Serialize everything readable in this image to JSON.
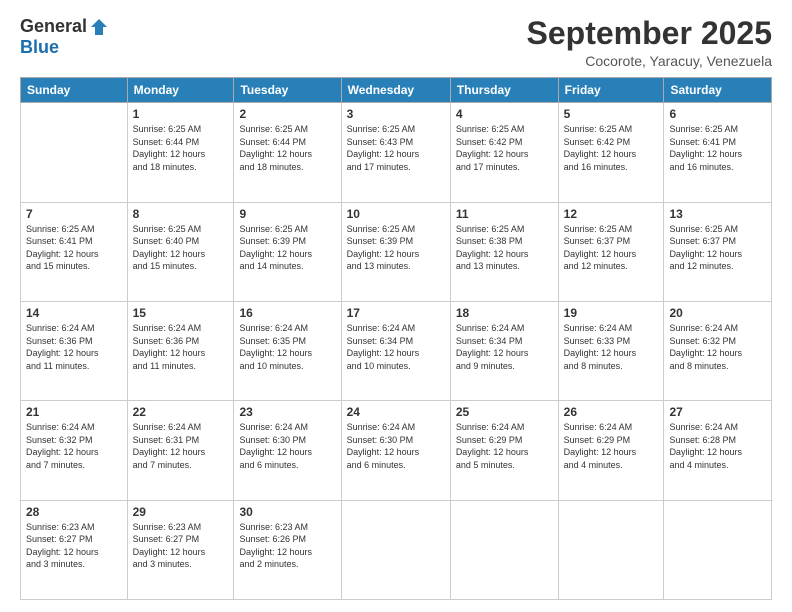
{
  "logo": {
    "general": "General",
    "blue": "Blue"
  },
  "header": {
    "month": "September 2025",
    "location": "Cocorote, Yaracuy, Venezuela"
  },
  "weekdays": [
    "Sunday",
    "Monday",
    "Tuesday",
    "Wednesday",
    "Thursday",
    "Friday",
    "Saturday"
  ],
  "weeks": [
    [
      {
        "day": "",
        "info": ""
      },
      {
        "day": "1",
        "info": "Sunrise: 6:25 AM\nSunset: 6:44 PM\nDaylight: 12 hours\nand 18 minutes."
      },
      {
        "day": "2",
        "info": "Sunrise: 6:25 AM\nSunset: 6:44 PM\nDaylight: 12 hours\nand 18 minutes."
      },
      {
        "day": "3",
        "info": "Sunrise: 6:25 AM\nSunset: 6:43 PM\nDaylight: 12 hours\nand 17 minutes."
      },
      {
        "day": "4",
        "info": "Sunrise: 6:25 AM\nSunset: 6:42 PM\nDaylight: 12 hours\nand 17 minutes."
      },
      {
        "day": "5",
        "info": "Sunrise: 6:25 AM\nSunset: 6:42 PM\nDaylight: 12 hours\nand 16 minutes."
      },
      {
        "day": "6",
        "info": "Sunrise: 6:25 AM\nSunset: 6:41 PM\nDaylight: 12 hours\nand 16 minutes."
      }
    ],
    [
      {
        "day": "7",
        "info": "Sunrise: 6:25 AM\nSunset: 6:41 PM\nDaylight: 12 hours\nand 15 minutes."
      },
      {
        "day": "8",
        "info": "Sunrise: 6:25 AM\nSunset: 6:40 PM\nDaylight: 12 hours\nand 15 minutes."
      },
      {
        "day": "9",
        "info": "Sunrise: 6:25 AM\nSunset: 6:39 PM\nDaylight: 12 hours\nand 14 minutes."
      },
      {
        "day": "10",
        "info": "Sunrise: 6:25 AM\nSunset: 6:39 PM\nDaylight: 12 hours\nand 13 minutes."
      },
      {
        "day": "11",
        "info": "Sunrise: 6:25 AM\nSunset: 6:38 PM\nDaylight: 12 hours\nand 13 minutes."
      },
      {
        "day": "12",
        "info": "Sunrise: 6:25 AM\nSunset: 6:37 PM\nDaylight: 12 hours\nand 12 minutes."
      },
      {
        "day": "13",
        "info": "Sunrise: 6:25 AM\nSunset: 6:37 PM\nDaylight: 12 hours\nand 12 minutes."
      }
    ],
    [
      {
        "day": "14",
        "info": "Sunrise: 6:24 AM\nSunset: 6:36 PM\nDaylight: 12 hours\nand 11 minutes."
      },
      {
        "day": "15",
        "info": "Sunrise: 6:24 AM\nSunset: 6:36 PM\nDaylight: 12 hours\nand 11 minutes."
      },
      {
        "day": "16",
        "info": "Sunrise: 6:24 AM\nSunset: 6:35 PM\nDaylight: 12 hours\nand 10 minutes."
      },
      {
        "day": "17",
        "info": "Sunrise: 6:24 AM\nSunset: 6:34 PM\nDaylight: 12 hours\nand 10 minutes."
      },
      {
        "day": "18",
        "info": "Sunrise: 6:24 AM\nSunset: 6:34 PM\nDaylight: 12 hours\nand 9 minutes."
      },
      {
        "day": "19",
        "info": "Sunrise: 6:24 AM\nSunset: 6:33 PM\nDaylight: 12 hours\nand 8 minutes."
      },
      {
        "day": "20",
        "info": "Sunrise: 6:24 AM\nSunset: 6:32 PM\nDaylight: 12 hours\nand 8 minutes."
      }
    ],
    [
      {
        "day": "21",
        "info": "Sunrise: 6:24 AM\nSunset: 6:32 PM\nDaylight: 12 hours\nand 7 minutes."
      },
      {
        "day": "22",
        "info": "Sunrise: 6:24 AM\nSunset: 6:31 PM\nDaylight: 12 hours\nand 7 minutes."
      },
      {
        "day": "23",
        "info": "Sunrise: 6:24 AM\nSunset: 6:30 PM\nDaylight: 12 hours\nand 6 minutes."
      },
      {
        "day": "24",
        "info": "Sunrise: 6:24 AM\nSunset: 6:30 PM\nDaylight: 12 hours\nand 6 minutes."
      },
      {
        "day": "25",
        "info": "Sunrise: 6:24 AM\nSunset: 6:29 PM\nDaylight: 12 hours\nand 5 minutes."
      },
      {
        "day": "26",
        "info": "Sunrise: 6:24 AM\nSunset: 6:29 PM\nDaylight: 12 hours\nand 4 minutes."
      },
      {
        "day": "27",
        "info": "Sunrise: 6:24 AM\nSunset: 6:28 PM\nDaylight: 12 hours\nand 4 minutes."
      }
    ],
    [
      {
        "day": "28",
        "info": "Sunrise: 6:23 AM\nSunset: 6:27 PM\nDaylight: 12 hours\nand 3 minutes."
      },
      {
        "day": "29",
        "info": "Sunrise: 6:23 AM\nSunset: 6:27 PM\nDaylight: 12 hours\nand 3 minutes."
      },
      {
        "day": "30",
        "info": "Sunrise: 6:23 AM\nSunset: 6:26 PM\nDaylight: 12 hours\nand 2 minutes."
      },
      {
        "day": "",
        "info": ""
      },
      {
        "day": "",
        "info": ""
      },
      {
        "day": "",
        "info": ""
      },
      {
        "day": "",
        "info": ""
      }
    ]
  ]
}
